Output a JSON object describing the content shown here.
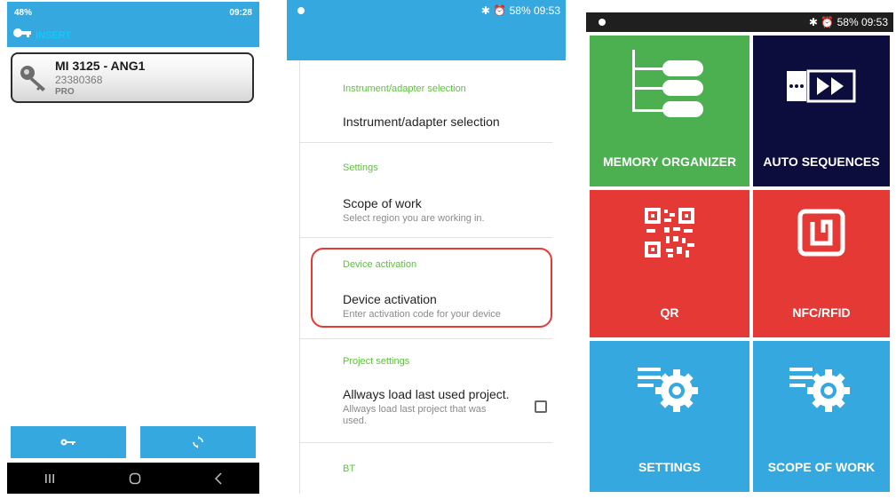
{
  "phone1": {
    "status": {
      "left": "48%",
      "right": "09:28"
    },
    "appbar": {
      "title": "INSERT"
    },
    "device": {
      "name": "MI 3125 - ANG1",
      "serial": "23380368",
      "tier": "PRO"
    },
    "buttons": [
      {
        "icon": "key-icon"
      },
      {
        "icon": "refresh-icon"
      }
    ],
    "navbar": [
      "recent-apps-icon",
      "home-icon",
      "back-icon"
    ]
  },
  "phone2": {
    "status": {
      "right": "58% 09:53"
    },
    "sections": [
      {
        "category": "Instrument/adapter selection",
        "items": [
          {
            "title": "Instrument/adapter selection",
            "summary": ""
          }
        ]
      },
      {
        "category": "Settings",
        "items": [
          {
            "title": "Scope of work",
            "summary": "Select region you are working in."
          }
        ]
      },
      {
        "category": "Device activation",
        "items": [
          {
            "title": "Device activation",
            "summary": "Enter activation code for your device"
          }
        ]
      },
      {
        "category": "Project settings",
        "items": [
          {
            "title": "Allways load last used project.",
            "summary_line1": "Allways load last project that was",
            "summary_line2": "used.",
            "checked": false
          }
        ]
      },
      {
        "category": "BT",
        "items": []
      }
    ],
    "highlight": "Device activation"
  },
  "phone3": {
    "status": {
      "right": "58% 09:53"
    },
    "tiles": [
      {
        "label": "MEMORY ORGANIZER",
        "color": "#4caf50",
        "icon": "memory-tree-icon"
      },
      {
        "label": "AUTO SEQUENCES",
        "color": "#0d0d3d",
        "icon": "fast-forward-icon"
      },
      {
        "label": "QR",
        "color": "#e53935",
        "icon": "qr-code-icon"
      },
      {
        "label": "NFC/RFID",
        "color": "#e53935",
        "icon": "nfc-icon"
      },
      {
        "label": "SETTINGS",
        "color": "#36a8e0",
        "icon": "settings-gear-icon"
      },
      {
        "label": "SCOPE OF WORK",
        "color": "#36a8e0",
        "icon": "scope-gear-icon"
      }
    ]
  },
  "colors": {
    "primary": "#36a8e0",
    "green": "#4caf50",
    "red": "#e53935",
    "navy": "#0d0d3d",
    "category": "#5fbf3f"
  }
}
